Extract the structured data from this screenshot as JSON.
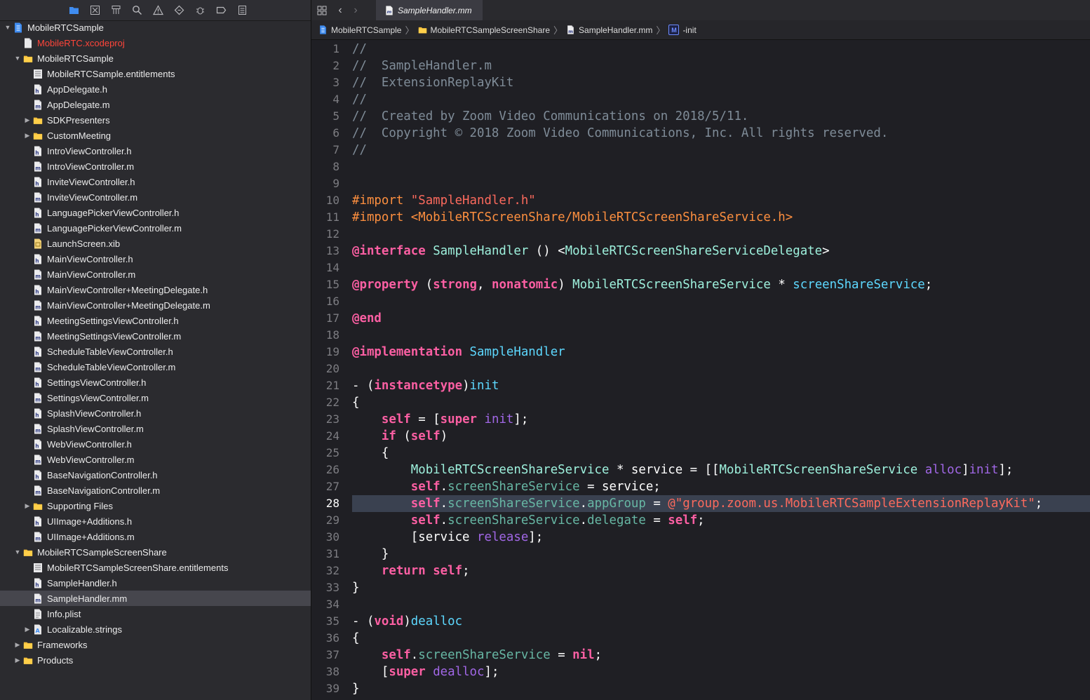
{
  "navigator": {
    "toolbar_icons": [
      "folder-icon",
      "source-control-icon",
      "hierarchy-icon",
      "search-icon",
      "warning-icon",
      "test-icon",
      "debug-icon",
      "breakpoint-icon",
      "report-icon"
    ],
    "tree": [
      {
        "label": "MobileRTCSample",
        "level": 0,
        "arrow": "down",
        "icon": "project"
      },
      {
        "label": "MobileRTC.xcodeproj",
        "level": 1,
        "arrow": "none",
        "icon": "doc",
        "red": true
      },
      {
        "label": "MobileRTCSample",
        "level": 1,
        "arrow": "down",
        "icon": "folder"
      },
      {
        "label": "MobileRTCSample.entitlements",
        "level": 2,
        "arrow": "none",
        "icon": "entitlements"
      },
      {
        "label": "AppDelegate.h",
        "level": 2,
        "arrow": "none",
        "icon": "h"
      },
      {
        "label": "AppDelegate.m",
        "level": 2,
        "arrow": "none",
        "icon": "m"
      },
      {
        "label": "SDKPresenters",
        "level": 2,
        "arrow": "right",
        "icon": "folder"
      },
      {
        "label": "CustomMeeting",
        "level": 2,
        "arrow": "right",
        "icon": "folder"
      },
      {
        "label": "IntroViewController.h",
        "level": 2,
        "arrow": "none",
        "icon": "h"
      },
      {
        "label": "IntroViewController.m",
        "level": 2,
        "arrow": "none",
        "icon": "m"
      },
      {
        "label": "InviteViewController.h",
        "level": 2,
        "arrow": "none",
        "icon": "h"
      },
      {
        "label": "InviteViewController.m",
        "level": 2,
        "arrow": "none",
        "icon": "m"
      },
      {
        "label": "LanguagePickerViewController.h",
        "level": 2,
        "arrow": "none",
        "icon": "h"
      },
      {
        "label": "LanguagePickerViewController.m",
        "level": 2,
        "arrow": "none",
        "icon": "m"
      },
      {
        "label": "LaunchScreen.xib",
        "level": 2,
        "arrow": "none",
        "icon": "xib"
      },
      {
        "label": "MainViewController.h",
        "level": 2,
        "arrow": "none",
        "icon": "h"
      },
      {
        "label": "MainViewController.m",
        "level": 2,
        "arrow": "none",
        "icon": "m"
      },
      {
        "label": "MainViewController+MeetingDelegate.h",
        "level": 2,
        "arrow": "none",
        "icon": "h"
      },
      {
        "label": "MainViewController+MeetingDelegate.m",
        "level": 2,
        "arrow": "none",
        "icon": "m"
      },
      {
        "label": "MeetingSettingsViewController.h",
        "level": 2,
        "arrow": "none",
        "icon": "h"
      },
      {
        "label": "MeetingSettingsViewController.m",
        "level": 2,
        "arrow": "none",
        "icon": "m"
      },
      {
        "label": "ScheduleTableViewController.h",
        "level": 2,
        "arrow": "none",
        "icon": "h"
      },
      {
        "label": "ScheduleTableViewController.m",
        "level": 2,
        "arrow": "none",
        "icon": "m"
      },
      {
        "label": "SettingsViewController.h",
        "level": 2,
        "arrow": "none",
        "icon": "h"
      },
      {
        "label": "SettingsViewController.m",
        "level": 2,
        "arrow": "none",
        "icon": "m"
      },
      {
        "label": "SplashViewController.h",
        "level": 2,
        "arrow": "none",
        "icon": "h"
      },
      {
        "label": "SplashViewController.m",
        "level": 2,
        "arrow": "none",
        "icon": "m"
      },
      {
        "label": "WebViewController.h",
        "level": 2,
        "arrow": "none",
        "icon": "h"
      },
      {
        "label": "WebViewController.m",
        "level": 2,
        "arrow": "none",
        "icon": "m"
      },
      {
        "label": "BaseNavigationController.h",
        "level": 2,
        "arrow": "none",
        "icon": "h"
      },
      {
        "label": "BaseNavigationController.m",
        "level": 2,
        "arrow": "none",
        "icon": "m"
      },
      {
        "label": "Supporting Files",
        "level": 2,
        "arrow": "right",
        "icon": "folder"
      },
      {
        "label": "UIImage+Additions.h",
        "level": 2,
        "arrow": "none",
        "icon": "h"
      },
      {
        "label": "UIImage+Additions.m",
        "level": 2,
        "arrow": "none",
        "icon": "m"
      },
      {
        "label": "MobileRTCSampleScreenShare",
        "level": 1,
        "arrow": "down",
        "icon": "folder"
      },
      {
        "label": "MobileRTCSampleScreenShare.entitlements",
        "level": 2,
        "arrow": "none",
        "icon": "entitlements"
      },
      {
        "label": "SampleHandler.h",
        "level": 2,
        "arrow": "none",
        "icon": "h"
      },
      {
        "label": "SampleHandler.mm",
        "level": 2,
        "arrow": "none",
        "icon": "m",
        "selected": true
      },
      {
        "label": "Info.plist",
        "level": 2,
        "arrow": "none",
        "icon": "plist"
      },
      {
        "label": "Localizable.strings",
        "level": 2,
        "arrow": "right",
        "icon": "strings"
      },
      {
        "label": "Frameworks",
        "level": 1,
        "arrow": "right",
        "icon": "folder"
      },
      {
        "label": "Products",
        "level": 1,
        "arrow": "right",
        "icon": "folder"
      }
    ]
  },
  "tabs": {
    "active": "SampleHandler.mm"
  },
  "breadcrumb": [
    {
      "label": "MobileRTCSample",
      "icon": "project"
    },
    {
      "label": "MobileRTCSampleScreenShare",
      "icon": "folder"
    },
    {
      "label": "SampleHandler.mm",
      "icon": "m"
    },
    {
      "label": "-init",
      "icon": "method",
      "badge": "M"
    }
  ],
  "editor": {
    "current_line": 28,
    "lines": [
      [
        [
          "c",
          "//"
        ]
      ],
      [
        [
          "c",
          "//  SampleHandler.m"
        ]
      ],
      [
        [
          "c",
          "//  ExtensionReplayKit"
        ]
      ],
      [
        [
          "c",
          "//"
        ]
      ],
      [
        [
          "c",
          "//  Created by Zoom Video Communications on 2018/5/11."
        ]
      ],
      [
        [
          "c",
          "//  Copyright © 2018 Zoom Video Communications, Inc. All rights reserved."
        ]
      ],
      [
        [
          "c",
          "//"
        ]
      ],
      [],
      [],
      [
        [
          "pp",
          "#import "
        ],
        [
          "str",
          "\"SampleHandler.h\""
        ]
      ],
      [
        [
          "pp",
          "#import <MobileRTCScreenShare/MobileRTCScreenShareService.h>"
        ]
      ],
      [],
      [
        [
          "kw",
          "@interface"
        ],
        [
          "plain",
          " "
        ],
        [
          "typ",
          "SampleHandler"
        ],
        [
          "plain",
          " () <"
        ],
        [
          "typ",
          "MobileRTCScreenShareServiceDelegate"
        ],
        [
          "plain",
          ">"
        ]
      ],
      [],
      [
        [
          "kw",
          "@property"
        ],
        [
          "plain",
          " ("
        ],
        [
          "kw",
          "strong"
        ],
        [
          "plain",
          ", "
        ],
        [
          "kw",
          "nonatomic"
        ],
        [
          "plain",
          ") "
        ],
        [
          "typ",
          "MobileRTCScreenShareService"
        ],
        [
          "plain",
          " * "
        ],
        [
          "decl",
          "screenShareService"
        ],
        [
          "plain",
          ";"
        ]
      ],
      [],
      [
        [
          "kw",
          "@end"
        ]
      ],
      [],
      [
        [
          "kw",
          "@implementation"
        ],
        [
          "plain",
          " "
        ],
        [
          "decl",
          "SampleHandler"
        ]
      ],
      [],
      [
        [
          "plain",
          "- ("
        ],
        [
          "kw",
          "instancetype"
        ],
        [
          "plain",
          ")"
        ],
        [
          "decl",
          "init"
        ]
      ],
      [
        [
          "plain",
          "{"
        ]
      ],
      [
        [
          "plain",
          "    "
        ],
        [
          "kw",
          "self"
        ],
        [
          "plain",
          " = ["
        ],
        [
          "kw",
          "super"
        ],
        [
          "plain",
          " "
        ],
        [
          "meth",
          "init"
        ],
        [
          "plain",
          "];"
        ]
      ],
      [
        [
          "plain",
          "    "
        ],
        [
          "kw",
          "if"
        ],
        [
          "plain",
          " ("
        ],
        [
          "kw",
          "self"
        ],
        [
          "plain",
          ")"
        ]
      ],
      [
        [
          "plain",
          "    {"
        ]
      ],
      [
        [
          "plain",
          "        "
        ],
        [
          "typ",
          "MobileRTCScreenShareService"
        ],
        [
          "plain",
          " * service = [["
        ],
        [
          "typ",
          "MobileRTCScreenShareService"
        ],
        [
          "plain",
          " "
        ],
        [
          "meth",
          "alloc"
        ],
        [
          "plain",
          "]"
        ],
        [
          "meth",
          "init"
        ],
        [
          "plain",
          "];"
        ]
      ],
      [
        [
          "plain",
          "        "
        ],
        [
          "kw",
          "self"
        ],
        [
          "plain",
          "."
        ],
        [
          "prop",
          "screenShareService"
        ],
        [
          "plain",
          " = service;"
        ]
      ],
      [
        [
          "plain",
          "        "
        ],
        [
          "kw",
          "self"
        ],
        [
          "plain",
          "."
        ],
        [
          "prop",
          "screenShareService"
        ],
        [
          "plain",
          "."
        ],
        [
          "prop",
          "appGroup"
        ],
        [
          "plain",
          " = "
        ],
        [
          "str",
          "@\"group.zoom.us.MobileRTCSampleExtensionReplayKit\""
        ],
        [
          "plain",
          ";"
        ]
      ],
      [
        [
          "plain",
          "        "
        ],
        [
          "kw",
          "self"
        ],
        [
          "plain",
          "."
        ],
        [
          "prop",
          "screenShareService"
        ],
        [
          "plain",
          "."
        ],
        [
          "prop",
          "delegate"
        ],
        [
          "plain",
          " = "
        ],
        [
          "kw",
          "self"
        ],
        [
          "plain",
          ";"
        ]
      ],
      [
        [
          "plain",
          "        [service "
        ],
        [
          "meth",
          "release"
        ],
        [
          "plain",
          "];"
        ]
      ],
      [
        [
          "plain",
          "    }"
        ]
      ],
      [
        [
          "plain",
          "    "
        ],
        [
          "kw",
          "return"
        ],
        [
          "plain",
          " "
        ],
        [
          "kw",
          "self"
        ],
        [
          "plain",
          ";"
        ]
      ],
      [
        [
          "plain",
          "}"
        ]
      ],
      [],
      [
        [
          "plain",
          "- ("
        ],
        [
          "kw",
          "void"
        ],
        [
          "plain",
          ")"
        ],
        [
          "decl",
          "dealloc"
        ]
      ],
      [
        [
          "plain",
          "{"
        ]
      ],
      [
        [
          "plain",
          "    "
        ],
        [
          "kw",
          "self"
        ],
        [
          "plain",
          "."
        ],
        [
          "prop",
          "screenShareService"
        ],
        [
          "plain",
          " = "
        ],
        [
          "kw",
          "nil"
        ],
        [
          "plain",
          ";"
        ]
      ],
      [
        [
          "plain",
          "    ["
        ],
        [
          "kw",
          "super"
        ],
        [
          "plain",
          " "
        ],
        [
          "meth",
          "dealloc"
        ],
        [
          "plain",
          "];"
        ]
      ],
      [
        [
          "plain",
          "}"
        ]
      ]
    ]
  }
}
